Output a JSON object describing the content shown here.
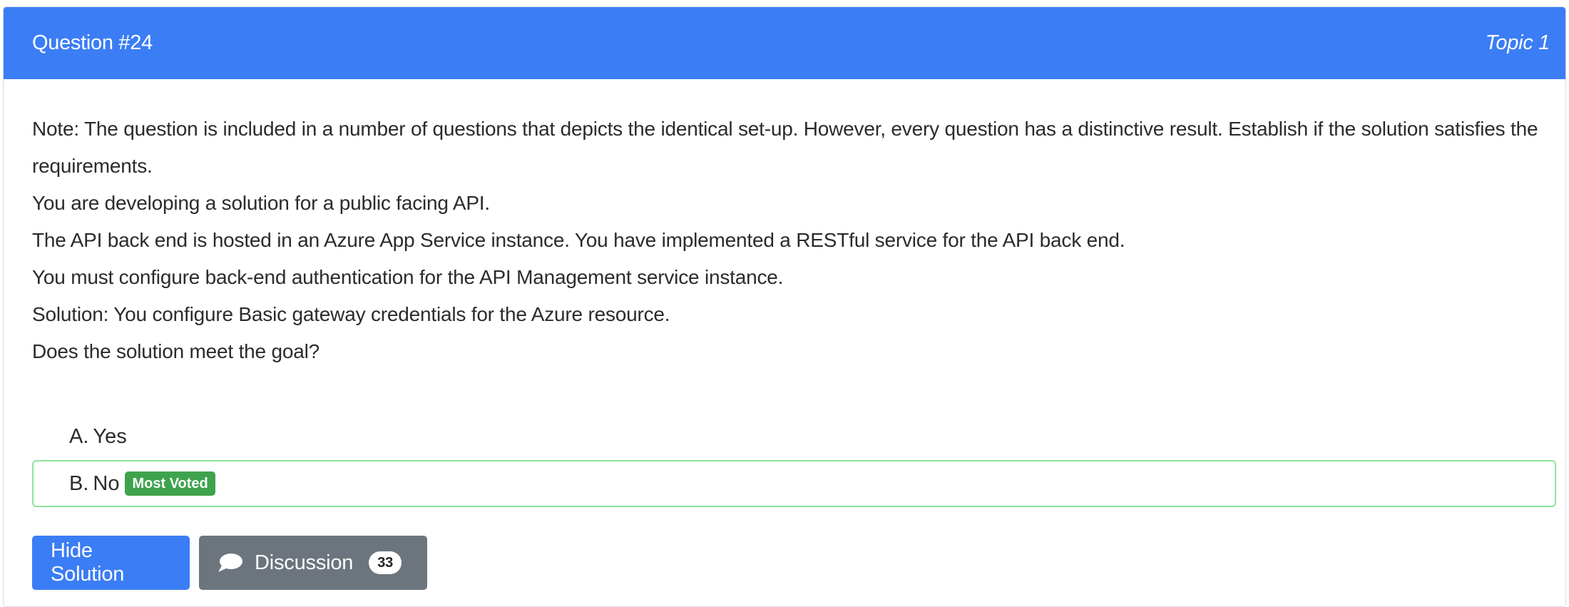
{
  "header": {
    "question_number": "Question #24",
    "topic": "Topic 1"
  },
  "question": {
    "paragraphs": [
      "Note: The question is included in a number of questions that depicts the identical set-up. However, every question has a distinctive result. Establish if the solution satisfies the requirements.",
      "You are developing a solution for a public facing API.",
      "The API back end is hosted in an Azure App Service instance. You have implemented a RESTful service for the API back end.",
      "You must configure back-end authentication for the API Management service instance.",
      "Solution: You configure Basic gateway credentials for the Azure resource.",
      "Does the solution meet the goal?"
    ]
  },
  "choices": [
    {
      "letter": "A.",
      "text": "Yes"
    },
    {
      "letter": "B.",
      "text": "No",
      "badge": "Most Voted"
    }
  ],
  "actions": {
    "hide_solution_label": "Hide Solution",
    "discussion_label": "Discussion",
    "discussion_count": "33"
  },
  "colors": {
    "header_bg": "#3b7df5",
    "primary_button": "#3b7df5",
    "secondary_button": "#6c757d",
    "most_voted_badge": "#3fa34d",
    "voted_border": "#8fe39a"
  },
  "icons": {
    "discussion": "comment-icon"
  }
}
